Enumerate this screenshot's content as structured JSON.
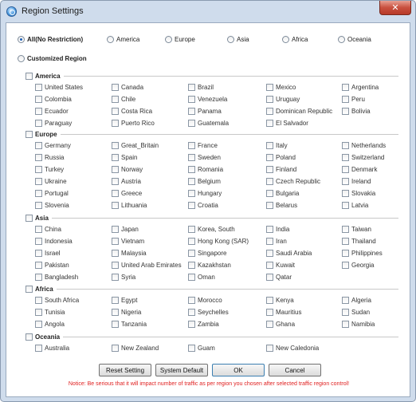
{
  "window": {
    "title": "Region Settings",
    "close_glyph": "✕"
  },
  "presets": [
    {
      "label": "All(No Restriction)",
      "selected": true
    },
    {
      "label": "America",
      "selected": false
    },
    {
      "label": "Europe",
      "selected": false
    },
    {
      "label": "Asia",
      "selected": false
    },
    {
      "label": "Africa",
      "selected": false
    },
    {
      "label": "Oceania",
      "selected": false
    }
  ],
  "custom_label": "Customized Region",
  "groups": [
    {
      "name": "America",
      "countries": [
        "United States",
        "Canada",
        "Brazil",
        "Mexico",
        "Argentina",
        "Colombia",
        "Chile",
        "Venezuela",
        "Uruguay",
        "Peru",
        "Ecuador",
        "Costa Rica",
        "Panama",
        "Dominican Republic",
        "Bolivia",
        "Paraguay",
        "Puerto Rico",
        "Guatemala",
        "El Salvador"
      ]
    },
    {
      "name": "Europe",
      "countries": [
        "Germany",
        "Great_Britain",
        "France",
        "Italy",
        "Netherlands",
        "Russia",
        "Spain",
        "Sweden",
        "Poland",
        "Switzerland",
        "Turkey",
        "Norway",
        "Romania",
        "Finland",
        "Denmark",
        "Ukraine",
        "Austria",
        "Belgium",
        "Czech Republic",
        "Ireland",
        "Portugal",
        "Greece",
        "Hungary",
        "Bulgaria",
        "Slovakia",
        "Slovenia",
        "Lithuania",
        "Croatia",
        "Belarus",
        "Latvia"
      ]
    },
    {
      "name": "Asia",
      "countries": [
        "China",
        "Japan",
        "Korea, South",
        "India",
        "Taiwan",
        "Indonesia",
        "Vietnam",
        "Hong Kong (SAR)",
        "Iran",
        "Thailand",
        "Israel",
        "Malaysia",
        "Singapore",
        "Saudi Arabia",
        "Philippines",
        "Pakistan",
        "United Arab Emirates",
        "Kazakhstan",
        "Kuwait",
        "Georgia",
        "Bangladesh",
        "Syria",
        "Oman",
        "Qatar"
      ]
    },
    {
      "name": "Africa",
      "countries": [
        "South Africa",
        "Egypt",
        "Morocco",
        "Kenya",
        "Algeria",
        "Tunisia",
        "Nigeria",
        "Seychelles",
        "Mauritius",
        "Sudan",
        "Angola",
        "Tanzania",
        "Zambia",
        "Ghana",
        "Namibia"
      ]
    },
    {
      "name": "Oceania",
      "countries": [
        "Australia",
        "New Zealand",
        "Guam",
        "New Caledonia"
      ]
    }
  ],
  "buttons": {
    "reset": "Reset Setting",
    "default": "System Default",
    "ok": "OK",
    "cancel": "Cancel"
  },
  "notice": "Notice: Be serious that it will impact number of traffic as per region you chosen after selected traffic region control!"
}
